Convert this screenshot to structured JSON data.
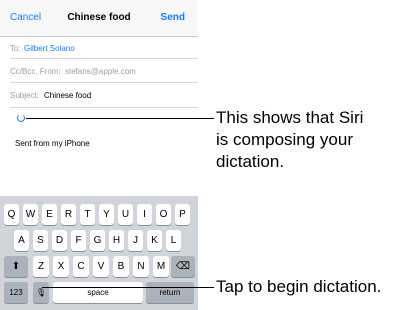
{
  "nav": {
    "cancel": "Cancel",
    "title": "Chinese food",
    "send": "Send"
  },
  "to": {
    "label": "To:",
    "value": "Gilbert Solano"
  },
  "cc": {
    "label": "Cc/Bcc, From:",
    "value": "stefans@apple.com"
  },
  "subject": {
    "label": "Subject:",
    "value": "Chinese food"
  },
  "body": {
    "signature": "Sent from my iPhone"
  },
  "keyboard": {
    "row1": [
      "Q",
      "W",
      "E",
      "R",
      "T",
      "Y",
      "U",
      "I",
      "O",
      "P"
    ],
    "row2": [
      "A",
      "S",
      "D",
      "F",
      "G",
      "H",
      "J",
      "K",
      "L"
    ],
    "row3": [
      "Z",
      "X",
      "C",
      "V",
      "B",
      "N",
      "M"
    ],
    "shift": "⬆",
    "backspace": "⌫",
    "numbers": "123",
    "mic": "🎙",
    "space": "space",
    "return": "return"
  },
  "annotations": {
    "siri_line1": "This shows that Siri",
    "siri_line2": "is composing your",
    "siri_line3": "dictation.",
    "dictation": "Tap to begin dictation."
  }
}
